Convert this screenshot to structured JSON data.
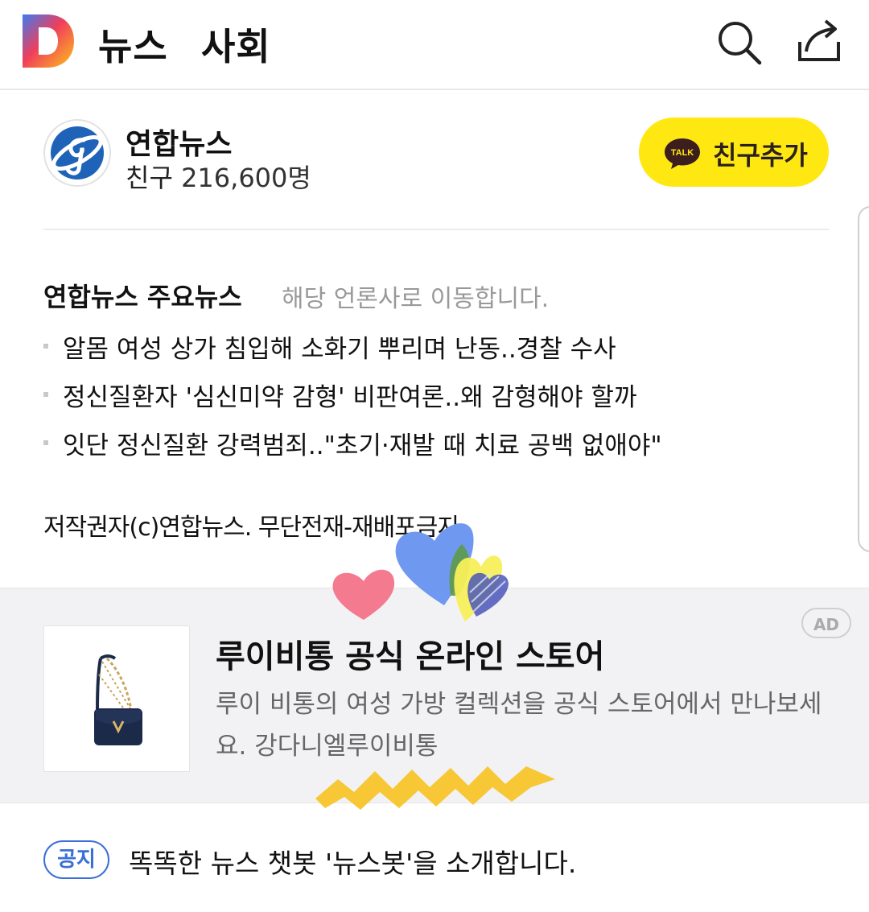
{
  "header": {
    "nav": [
      "뉴스",
      "사회"
    ],
    "icons": {
      "search": "search-icon",
      "share": "share-icon",
      "logo": "daum-d-logo"
    }
  },
  "publisher": {
    "name": "연합뉴스",
    "friends_label": "친구",
    "friends_count": "216,600명",
    "add_friend_label": "친구추가",
    "talk_badge": "TALK"
  },
  "main_news": {
    "title": "연합뉴스 주요뉴스",
    "subtitle": "해당 언론사로 이동합니다.",
    "items": [
      "알몸 여성 상가 침입해 소화기 뿌리며 난동..경찰 수사",
      "정신질환자 '심신미약 감형' 비판여론..왜 감형해야 할까",
      "잇단 정신질환 강력범죄..\"초기·재발 때 치료 공백 없애야\""
    ],
    "copyright": "저작권자(c)연합뉴스. 무단전재-재배포금지"
  },
  "ad": {
    "badge": "AD",
    "title": "루이비통 공식 온라인 스토어",
    "description": "루이 비통의 여성 가방 컬렉션을 공식 스토어에서 만나보세요. 강다니엘루이비통"
  },
  "notice": {
    "tag": "공지",
    "text": "똑똑한 뉴스 챗봇 '뉴스봇'을 소개합니다."
  },
  "colors": {
    "kakao_yellow": "#ffe812",
    "notice_blue": "#3a6fd8",
    "ad_bg": "#f2f2f4"
  }
}
